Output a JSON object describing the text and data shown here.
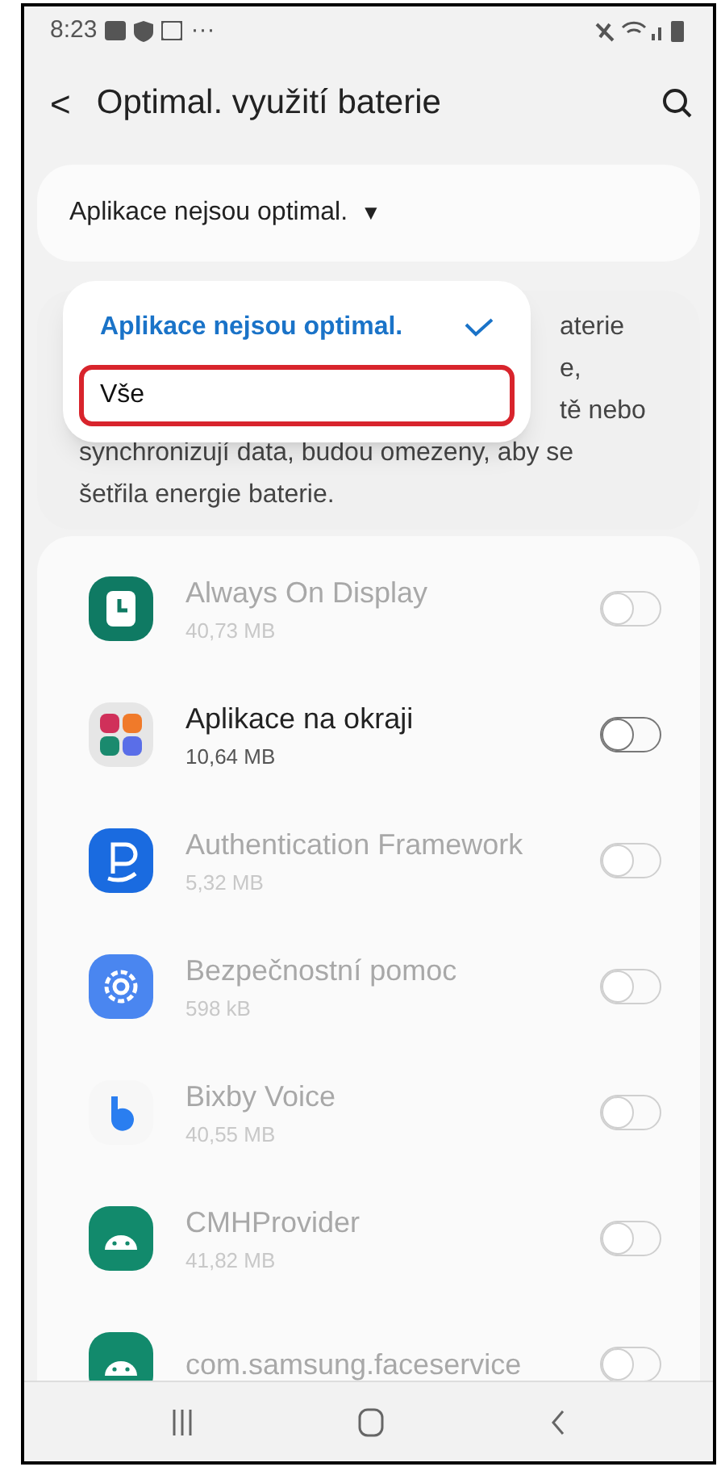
{
  "status_bar": {
    "time": "8:23",
    "more": "···"
  },
  "header": {
    "back": "<",
    "title": "Optimal. využití baterie"
  },
  "filter": {
    "label": "Aplikace nejsou optimal.",
    "arrow": "▼"
  },
  "description": {
    "fragments": [
      "aterie",
      "e,",
      "tě nebo"
    ],
    "lines": [
      "synchronizují data, budou omezeny, aby se",
      "šetřila energie baterie."
    ]
  },
  "menu": {
    "items": [
      {
        "label": "Aplikace nejsou optimal.",
        "selected": true,
        "highlighted": false
      },
      {
        "label": "Vše",
        "selected": false,
        "highlighted": true
      }
    ]
  },
  "apps": [
    {
      "name": "Always On Display",
      "size": "40,73 MB",
      "disabled": true,
      "on": false
    },
    {
      "name": "Aplikace na okraji",
      "size": "10,64 MB",
      "disabled": false,
      "on": false
    },
    {
      "name": "Authentication Framework",
      "size": "5,32 MB",
      "disabled": true,
      "on": false
    },
    {
      "name": "Bezpečnostní pomoc",
      "size": "598 kB",
      "disabled": true,
      "on": false
    },
    {
      "name": "Bixby Voice",
      "size": "40,55 MB",
      "disabled": true,
      "on": false
    },
    {
      "name": "CMHProvider",
      "size": "41,82 MB",
      "disabled": true,
      "on": false
    },
    {
      "name": "com.samsung.faceservice",
      "disabled": true,
      "on": false
    }
  ]
}
